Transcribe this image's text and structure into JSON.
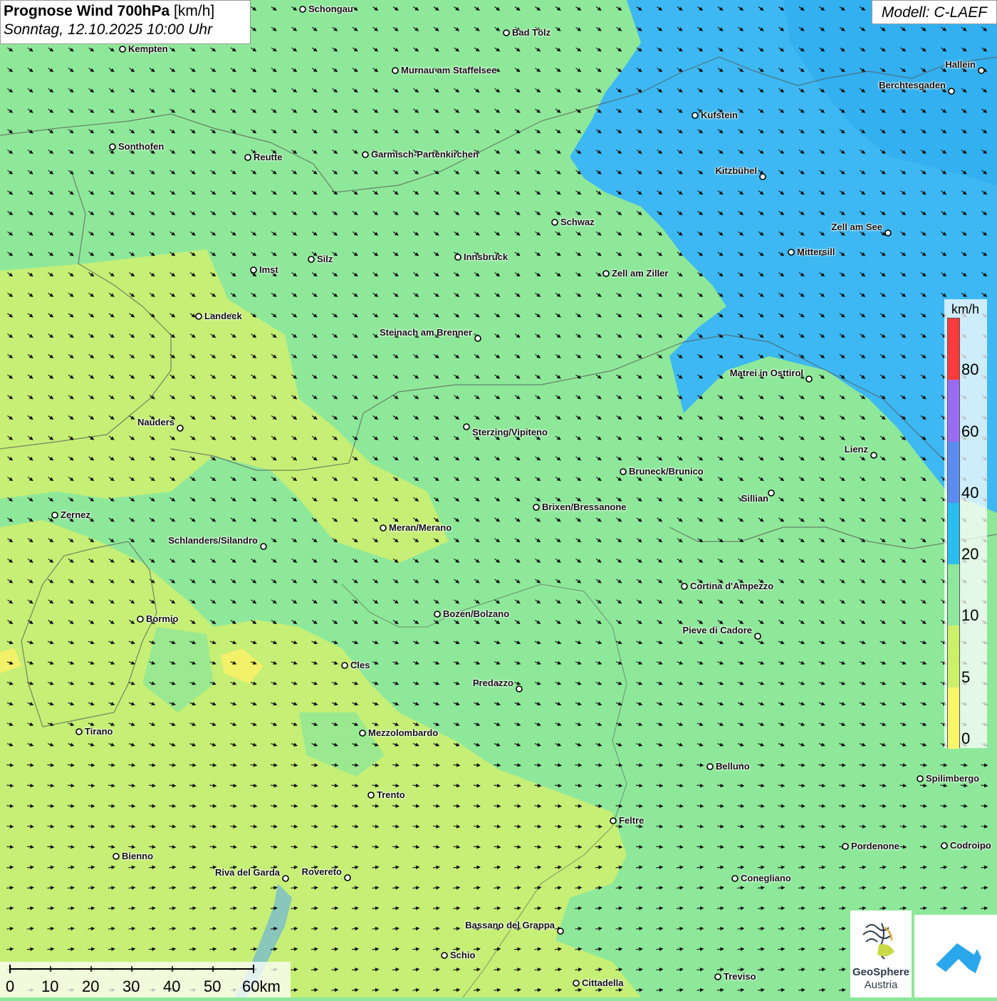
{
  "title": {
    "main": "Prognose Wind 700hPa",
    "unit": "[km/h]",
    "datetime": "Sonntag, 12.10.2025 10:00 Uhr"
  },
  "model": "Modell: C-LAEF",
  "legend": {
    "unit": "km/h",
    "ticks": [
      "80",
      "60",
      "40",
      "20",
      "10",
      "5",
      "0"
    ],
    "colors": [
      "#ff3a3a",
      "#9a6cf2",
      "#5b8cf0",
      "#29bff0",
      "#8ee89a",
      "#cdf06a",
      "#fbf56a"
    ]
  },
  "scalebar": {
    "labels": [
      "0",
      "10",
      "20",
      "30",
      "40",
      "50",
      "60km"
    ]
  },
  "logo": {
    "line1": "GeoSphere",
    "line2": "Austria"
  },
  "cities": [
    {
      "name": "Schongau",
      "label": "Schongau"
    },
    {
      "name": "Bad Tölz",
      "label": "Bad Tölz"
    },
    {
      "name": "Kempten",
      "label": "Kempten"
    },
    {
      "name": "Murnau am Staffelsee",
      "label": "Murnau am Staffelsee"
    },
    {
      "name": "Hallein",
      "label": "Hallein"
    },
    {
      "name": "Berchtesgaden",
      "label": "Berchtesgaden"
    },
    {
      "name": "Kufstein",
      "label": "Kufstein"
    },
    {
      "name": "Sonthofen",
      "label": "Sonthofen"
    },
    {
      "name": "Reutte",
      "label": "Reutte"
    },
    {
      "name": "Garmisch-Partenkirchen",
      "label": "Garmisch-Partenkirchen"
    },
    {
      "name": "Kitzbühel",
      "label": "Kitzbühel"
    },
    {
      "name": "Schwaz",
      "label": "Schwaz"
    },
    {
      "name": "Zell am See",
      "label": "Zell am See"
    },
    {
      "name": "Mittersill",
      "label": "Mittersill"
    },
    {
      "name": "Innsbruck",
      "label": "Innsbruck"
    },
    {
      "name": "Silz",
      "label": "Silz"
    },
    {
      "name": "Imst",
      "label": "Imst"
    },
    {
      "name": "Zell am Ziller",
      "label": "Zell am Ziller"
    },
    {
      "name": "Landeck",
      "label": "Landeck"
    },
    {
      "name": "Steinach am Brenner",
      "label": "Steinach am Brenner"
    },
    {
      "name": "Matrei in Osttirol",
      "label": "Matrei in Osttirol"
    },
    {
      "name": "Nauders",
      "label": "Nauders"
    },
    {
      "name": "Sterzing/Vipiteno",
      "label": "Sterzing/Vipiteno"
    },
    {
      "name": "Lienz",
      "label": "Lienz"
    },
    {
      "name": "Bruneck/Brunico",
      "label": "Bruneck/Brunico"
    },
    {
      "name": "Sillian",
      "label": "Sillian"
    },
    {
      "name": "Brixen/Bressanone",
      "label": "Brixen/Bressanone"
    },
    {
      "name": "Zernez",
      "label": "Zernez"
    },
    {
      "name": "Meran/Merano",
      "label": "Meran/Merano"
    },
    {
      "name": "Schlanders/Silandro",
      "label": "Schlanders/Silandro"
    },
    {
      "name": "Cortina d'Ampezzo",
      "label": "Cortina d'Ampezzo"
    },
    {
      "name": "Bormio",
      "label": "Bormio"
    },
    {
      "name": "Bozen/Bolzano",
      "label": "Bozen/Bolzano"
    },
    {
      "name": "Pieve di Cadore",
      "label": "Pieve di Cadore"
    },
    {
      "name": "Cles",
      "label": "Cles"
    },
    {
      "name": "Predazzo",
      "label": "Predazzo"
    },
    {
      "name": "Tirano",
      "label": "Tirano"
    },
    {
      "name": "Mezzolombardo",
      "label": "Mezzolombardo"
    },
    {
      "name": "Belluno",
      "label": "Belluno"
    },
    {
      "name": "Spilimbergo",
      "label": "Spilimbergo"
    },
    {
      "name": "Trento",
      "label": "Trento"
    },
    {
      "name": "Feltre",
      "label": "Feltre"
    },
    {
      "name": "Pordenone",
      "label": "Pordenone"
    },
    {
      "name": "Codroipo",
      "label": "Codroipo"
    },
    {
      "name": "Bienno",
      "label": "Bienno"
    },
    {
      "name": "Riva del Garda",
      "label": "Riva del Garda"
    },
    {
      "name": "Rovereto",
      "label": "Rovereto"
    },
    {
      "name": "Conegliano",
      "label": "Conegliano"
    },
    {
      "name": "Bassano del Grappa",
      "label": "Bassano del Grappa"
    },
    {
      "name": "Schio",
      "label": "Schio"
    },
    {
      "name": "Treviso",
      "label": "Treviso"
    },
    {
      "name": "Cittadella",
      "label": "Cittadella"
    }
  ]
}
